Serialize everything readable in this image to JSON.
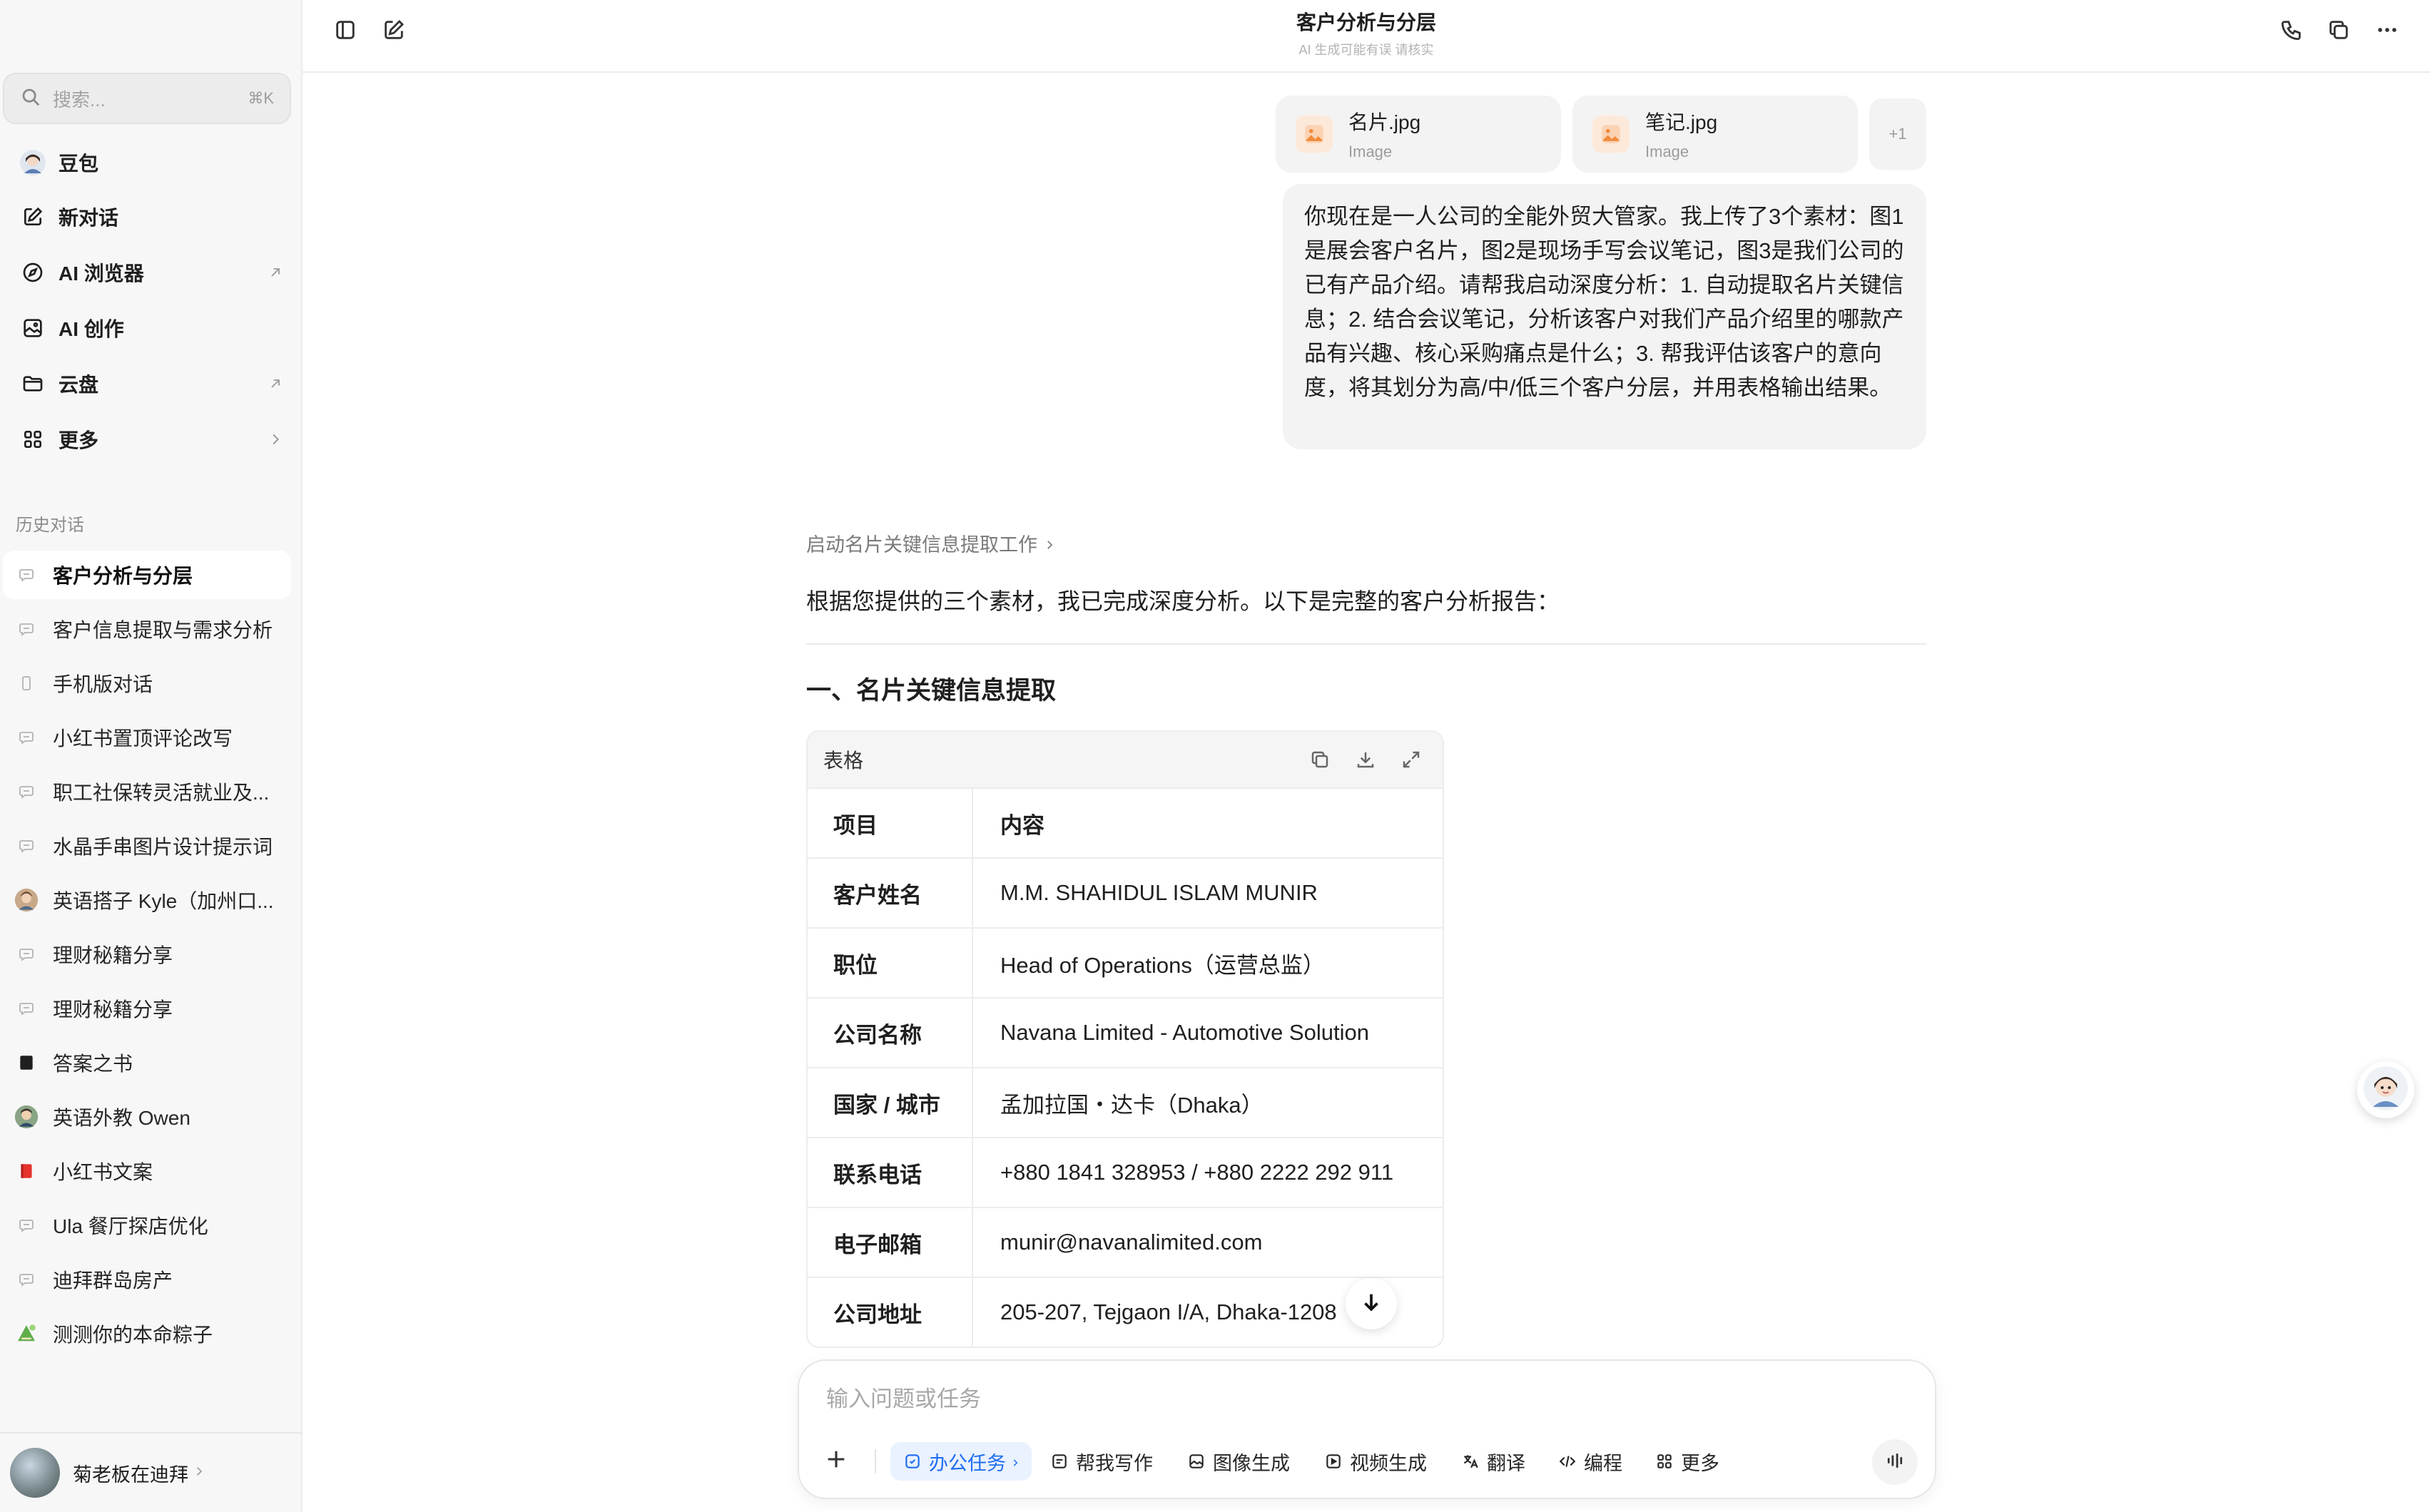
{
  "sidebar": {
    "search": {
      "placeholder": "搜索...",
      "shortcut": "⌘K"
    },
    "nav": [
      {
        "label": "豆包",
        "icon": "avatar-icon"
      },
      {
        "label": "新对话",
        "icon": "edit-icon"
      },
      {
        "label": "AI 浏览器",
        "icon": "compass-icon",
        "tail": "external-arrow-icon"
      },
      {
        "label": "AI 创作",
        "icon": "image-icon"
      },
      {
        "label": "云盘",
        "icon": "folder-icon",
        "tail": "external-arrow-icon"
      },
      {
        "label": "更多",
        "icon": "grid-icon",
        "tail": "chevron-right-icon"
      }
    ],
    "history_label": "历史对话",
    "history": [
      {
        "label": "客户分析与分层",
        "icon": "chat-icon",
        "active": true
      },
      {
        "label": "客户信息提取与需求分析",
        "icon": "chat-icon"
      },
      {
        "label": "手机版对话",
        "icon": "phone-icon"
      },
      {
        "label": "小红书置顶评论改写",
        "icon": "chat-icon"
      },
      {
        "label": "职工社保转灵活就业及...",
        "icon": "chat-icon"
      },
      {
        "label": "水晶手串图片设计提示词",
        "icon": "chat-icon"
      },
      {
        "label": "英语搭子 Kyle（加州口...",
        "icon": "bot-avatar-icon"
      },
      {
        "label": "理财秘籍分享",
        "icon": "chat-icon"
      },
      {
        "label": "理财秘籍分享",
        "icon": "chat-icon"
      },
      {
        "label": "答案之书",
        "icon": "book-icon"
      },
      {
        "label": "英语外教 Owen",
        "icon": "bot-avatar-icon"
      },
      {
        "label": "小红书文案",
        "icon": "red-book-icon"
      },
      {
        "label": "Ula 餐厅探店优化",
        "icon": "chat-icon"
      },
      {
        "label": "迪拜群岛房产",
        "icon": "chat-icon"
      },
      {
        "label": "测测你的本命粽子",
        "icon": "zongzi-icon"
      }
    ],
    "user": {
      "name": "菊老板在迪拜"
    }
  },
  "header": {
    "title": "客户分析与分层",
    "subtitle": "AI 生成可能有误 请核实"
  },
  "attachments": [
    {
      "name": "名片.jpg",
      "type": "Image"
    },
    {
      "name": "笔记.jpg",
      "type": "Image"
    }
  ],
  "attachments_more": "+1",
  "user_message": "你现在是一人公司的全能外贸大管家。我上传了3个素材：图1是展会客户名片，图2是现场手写会议笔记，图3是我们公司的已有产品介绍。请帮我启动深度分析：1. 自动提取名片关键信息；2. 结合会议笔记，分析该客户对我们产品介绍里的哪款产品有兴趣、核心采购痛点是什么；3. 帮我评估该客户的意向度，将其划分为高/中/低三个客户分层，并用表格输出结果。",
  "assistant": {
    "step_link": "启动名片关键信息提取工作",
    "intro": "根据您提供的三个素材，我已完成深度分析。以下是完整的客户分析报告：",
    "section_title": "一、名片关键信息提取",
    "table": {
      "label": "表格",
      "header": [
        "项目",
        "内容"
      ],
      "rows": [
        [
          "客户姓名",
          "M.M. SHAHIDUL ISLAM MUNIR"
        ],
        [
          "职位",
          "Head of Operations（运营总监）"
        ],
        [
          "公司名称",
          "Navana Limited - Automotive Solution"
        ],
        [
          "国家 / 城市",
          "孟加拉国・达卡（Dhaka）"
        ],
        [
          "联系电话",
          "+880 1841 328953 / +880 2222 292 911"
        ],
        [
          "电子邮箱",
          "munir@navanalimited.com"
        ],
        [
          "公司地址",
          "205-207, Tejgaon I/A, Dhaka-1208"
        ]
      ]
    }
  },
  "composer": {
    "placeholder": "输入问题或任务",
    "tools": [
      {
        "label": "办公任务",
        "icon": "office-task-icon",
        "active": true
      },
      {
        "label": "帮我写作",
        "icon": "writing-icon"
      },
      {
        "label": "图像生成",
        "icon": "image-gen-icon"
      },
      {
        "label": "视频生成",
        "icon": "video-gen-icon"
      },
      {
        "label": "翻译",
        "icon": "translate-icon"
      },
      {
        "label": "编程",
        "icon": "code-icon"
      },
      {
        "label": "更多",
        "icon": "grid-icon"
      }
    ]
  },
  "colors": {
    "accent": "#1f6df2",
    "sidebar_bg": "#f7f7f7",
    "bubble_bg": "#f3f3f3"
  }
}
